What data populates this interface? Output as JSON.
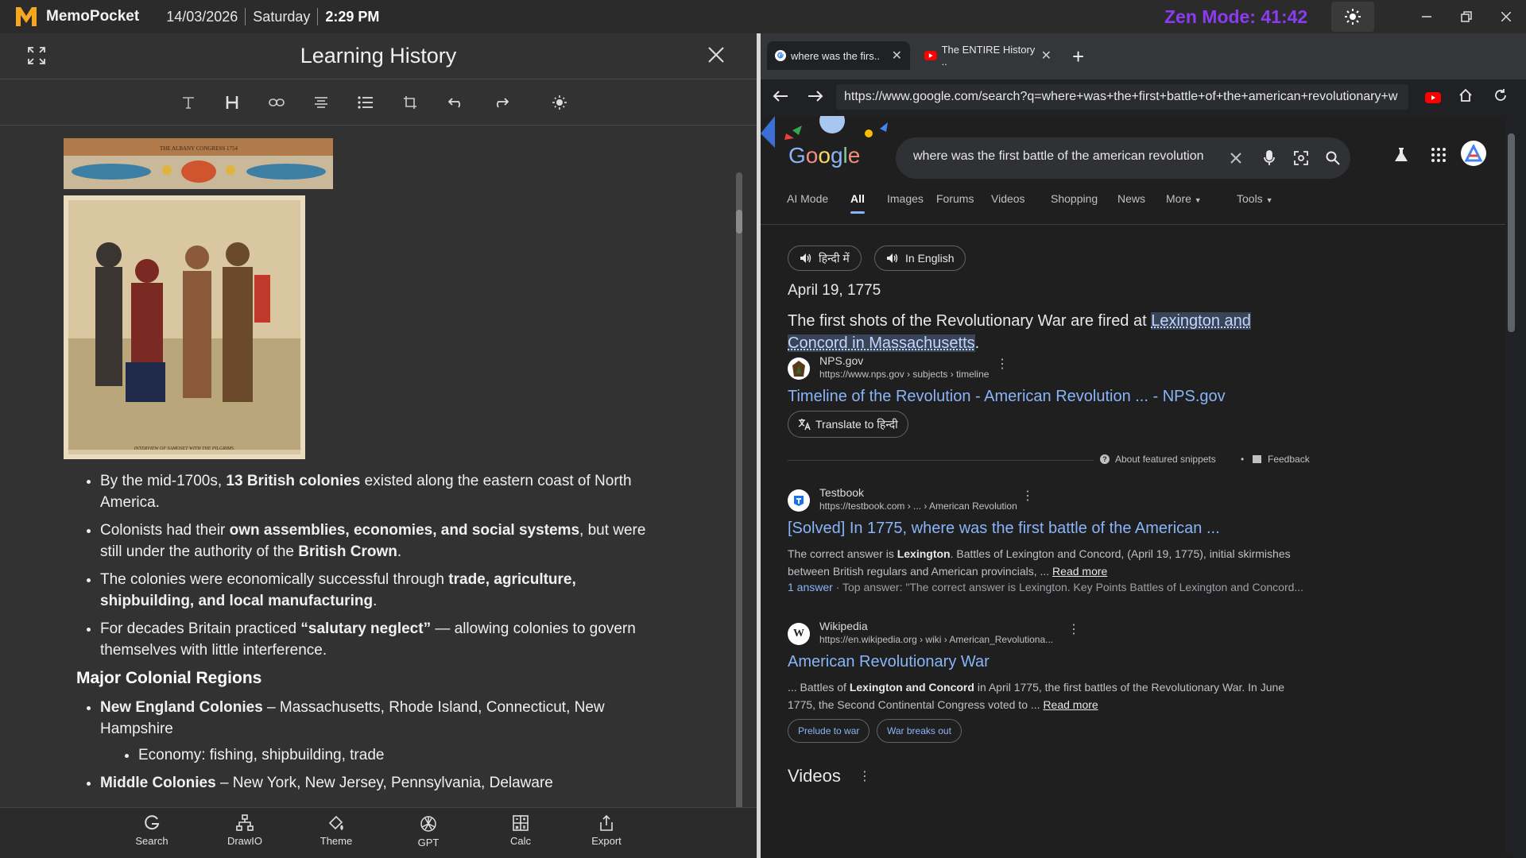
{
  "app": {
    "name": "MemoPocket",
    "date": "14/03/2026",
    "day": "Saturday",
    "time": "2:29 PM",
    "zen_mode": "Zen Mode: 41:42",
    "accent": "#8b3cf0",
    "logo_color": "#f5a623"
  },
  "notes_panel": {
    "title": "Learning History",
    "toolbar": [
      "text-format-icon",
      "heading-icon",
      "link-icon",
      "align-center-icon",
      "bullet-list-icon",
      "crop-icon",
      "undo-icon",
      "redo-icon",
      "brightness-icon"
    ],
    "image_caption_top": "THE ALBANY CONGRESS 1754",
    "image_caption_bottom": "INTERVIEW OF SAMOSET WITH THE PILGRIMS.",
    "bullets": [
      {
        "pre": "By the mid-1700s, ",
        "bold": "13 British colonies",
        "post": " existed along the eastern coast of North America."
      },
      {
        "pre": "Colonists had their ",
        "bold": "own assemblies, economies, and social systems",
        "post": ", but were still under the authority of the ",
        "bold2": "British Crown",
        "post2": "."
      },
      {
        "pre": "The colonies were economically successful through ",
        "bold": "trade, agriculture, shipbuilding, and local manufacturing",
        "post": "."
      },
      {
        "pre": "For decades Britain practiced ",
        "bold": "“salutary neglect”",
        "post": " — allowing colonies to govern themselves with little interference."
      }
    ],
    "section_heading": "Major Colonial Regions",
    "regions": [
      {
        "bold": "New England Colonies",
        "post": " – Massachusetts, Rhode Island, Connecticut, New Hampshire",
        "sub": "Economy: fishing, shipbuilding, trade"
      },
      {
        "bold": "Middle Colonies",
        "post": " – New York, New Jersey, Pennsylvania, Delaware"
      }
    ],
    "bottom_buttons": [
      "Search",
      "DrawIO",
      "Theme",
      "GPT",
      "Calc",
      "Export"
    ]
  },
  "browser": {
    "tabs": [
      {
        "title": "where was the firs..",
        "icon": "google-icon"
      },
      {
        "title": "The ENTIRE History ..",
        "icon": "youtube-icon"
      }
    ],
    "url": "https://www.google.com/search?q=where+was+the+first+battle+of+the+american+revolutionary+w",
    "search_query": "where was the first battle of the american revolution",
    "logo_text": "Google",
    "nav_tabs": [
      "AI Mode",
      "All",
      "Images",
      "Forums",
      "Videos",
      "Shopping",
      "News",
      "More",
      "Tools"
    ],
    "active_tab": "All",
    "lang_buttons": [
      "हिन्दी में",
      "In English"
    ],
    "answer_date": "April 19, 1775",
    "answer_pre": "The first shots of the Revolutionary War are fired at ",
    "answer_highlight": "Lexington and Concord in Massachusetts",
    "answer_post": ".",
    "featured": {
      "site": "NPS.gov",
      "crumb": "https://www.nps.gov › subjects › timeline",
      "title": "Timeline of the Revolution - American Revolution ... - NPS.gov",
      "translate": "Translate to हिन्दी",
      "about": "About featured snippets",
      "feedback": "Feedback"
    },
    "results": [
      {
        "site": "Testbook",
        "crumb": "https://testbook.com › ... › American Revolution",
        "title": "[Solved] In 1775, where was the first battle of the American ...",
        "snippet_pre": "The correct answer is ",
        "snippet_bold": "Lexington",
        "snippet_post": ". Battles of Lexington and Concord, (April 19, 1775), initial skirmishes between British regulars and American provincials, ... ",
        "read_more": "Read more",
        "meta_answer": "1 answer",
        "meta_rest": " · Top answer: \"The correct answer is Lexington. Key Points Battles of Lexington and Concord..."
      },
      {
        "site": "Wikipedia",
        "crumb": "https://en.wikipedia.org › wiki › American_Revolutiona...",
        "title": "American Revolutionary War",
        "snippet_pre": "... Battles of ",
        "snippet_bold": "Lexington and Concord",
        "snippet_post": " in April 1775, the first battles of the Revolutionary War. In June 1775, the Second Continental Congress voted to ... ",
        "read_more": "Read more",
        "chips": [
          "Prelude to war",
          "War breaks out"
        ]
      }
    ],
    "videos_heading": "Videos"
  }
}
